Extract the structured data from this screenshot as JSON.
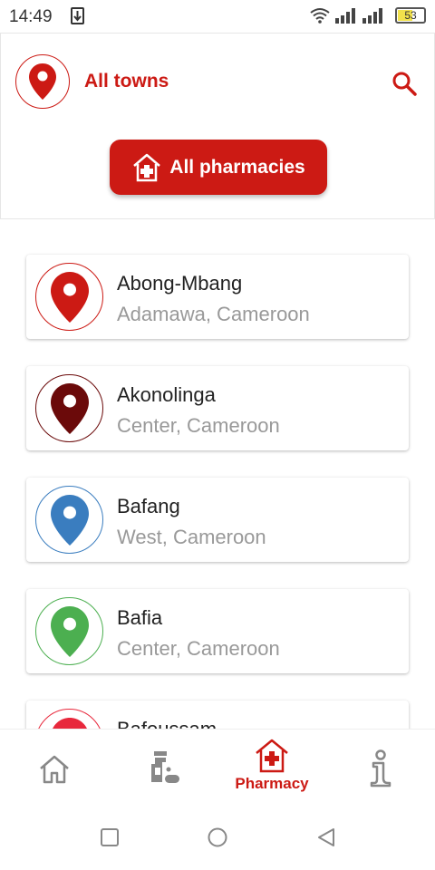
{
  "status_bar": {
    "time": "14:49",
    "battery": "53"
  },
  "header": {
    "title": "All towns",
    "pharmacies_button": "All pharmacies"
  },
  "towns": [
    {
      "name": "Abong-Mbang",
      "region": "Adamawa, Cameroon",
      "color": "#cc1a14"
    },
    {
      "name": "Akonolinga",
      "region": "Center, Cameroon",
      "color": "#6b0a0a"
    },
    {
      "name": "Bafang",
      "region": "West, Cameroon",
      "color": "#3a7dbf"
    },
    {
      "name": "Bafia",
      "region": "Center, Cameroon",
      "color": "#4caf50"
    },
    {
      "name": "Bafoussam",
      "region": "",
      "color": "#e8283c"
    }
  ],
  "bottom_nav": {
    "pharmacy_label": "Pharmacy"
  },
  "colors": {
    "accent": "#cc1a14"
  }
}
